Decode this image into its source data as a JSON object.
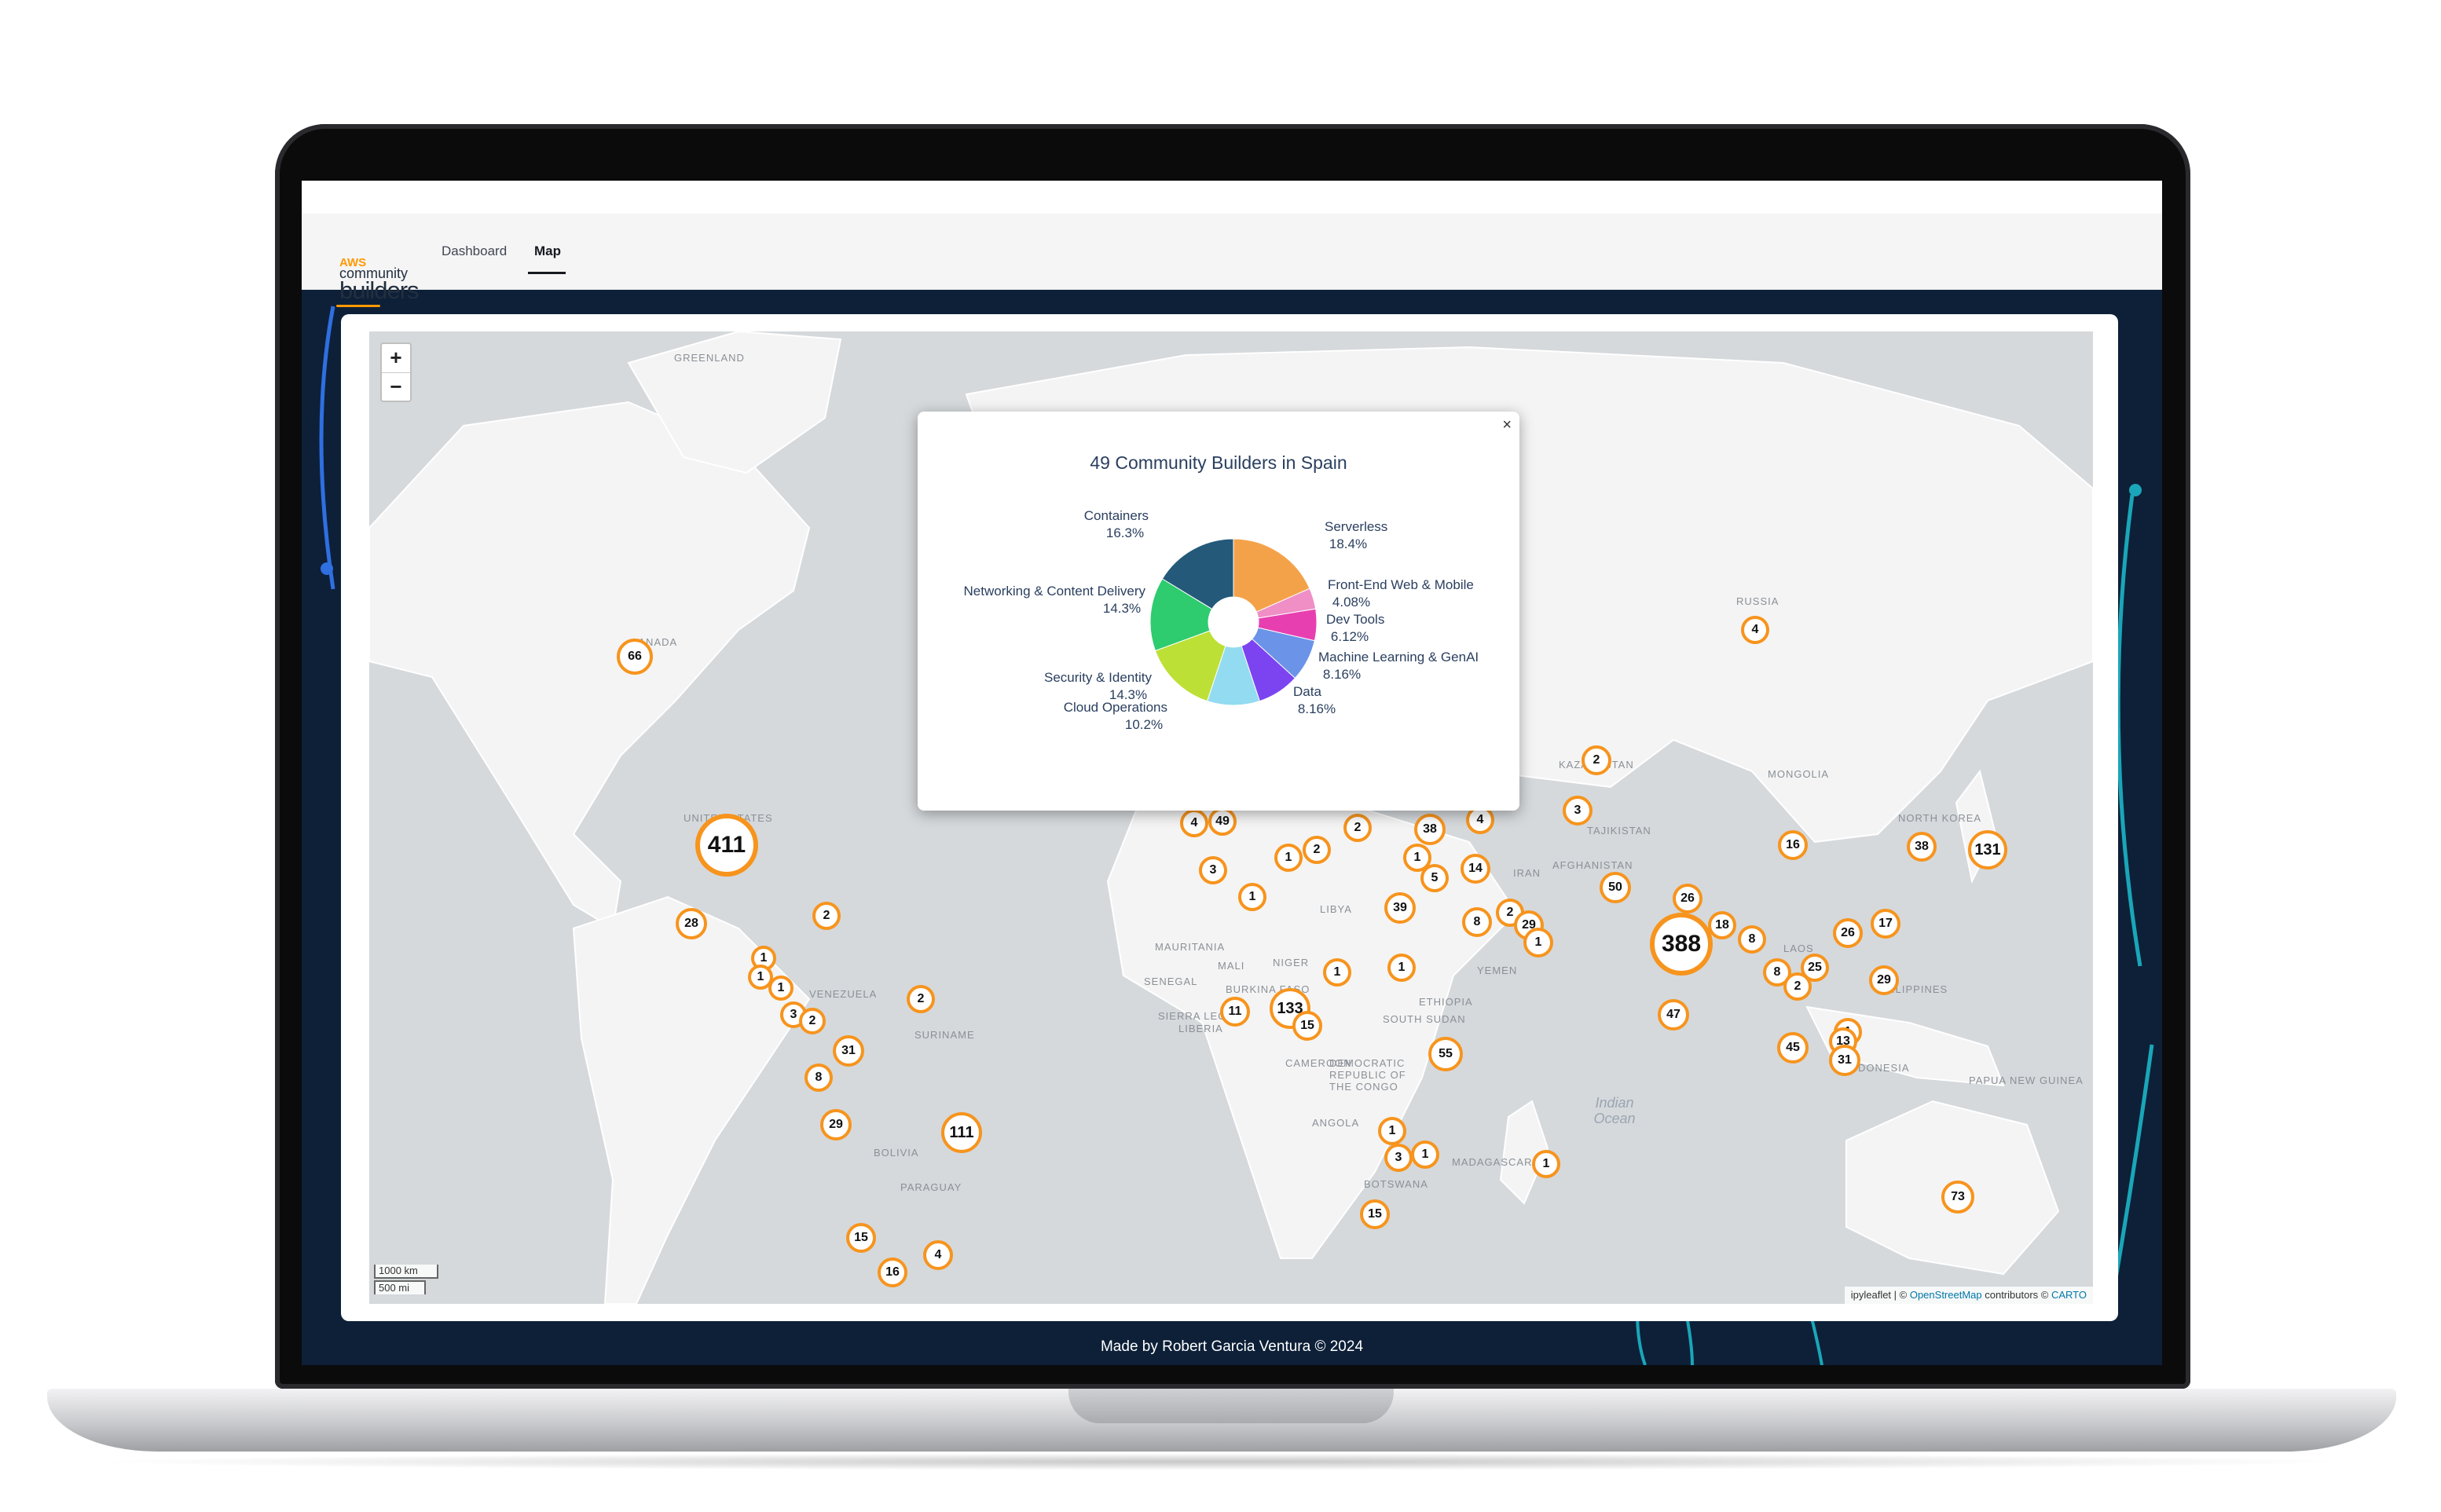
{
  "app": {
    "logo_aws": "AWS",
    "logo_line1": "community",
    "logo_line2": "builders",
    "tabs": [
      {
        "label": "Dashboard",
        "active": false
      },
      {
        "label": "Map",
        "active": true
      }
    ]
  },
  "map": {
    "zoom_in": "+",
    "zoom_out": "−",
    "scale_km": "1000 km",
    "scale_mi": "500 mi",
    "attribution": {
      "prefix": "ipyleaflet | © ",
      "osm": "OpenStreetMap",
      "mid": " contributors © ",
      "carto": "CARTO"
    },
    "place_labels": [
      "GREENLAND",
      "CANADA",
      "UNITED STATES",
      "RUSSIA",
      "KAZAKHSTAN",
      "MONGOLIA",
      "TAJIKISTAN",
      "AFGHANISTAN",
      "IRAN",
      "NORTH KOREA",
      "LAOS",
      "PHILIPPINES",
      "PAPUA NEW GUINEA",
      "INDONESIA",
      "MAURITANIA",
      "MALI",
      "NIGER",
      "LIBYA",
      "SENEGAL",
      "BURKINA FASO",
      "SIERRA LEONE",
      "LIBERIA",
      "CAMEROON",
      "ETHIOPIA",
      "SOUTH SUDAN",
      "DEMOCRATIC REPUBLIC OF THE CONGO",
      "ANGOLA",
      "BOTSWANA",
      "MADAGASCAR",
      "YEMEN",
      "VENEZUELA",
      "SURINAME",
      "BOLIVIA",
      "PARAGUAY",
      "Indian Ocean"
    ],
    "clusters": [
      {
        "count": "66"
      },
      {
        "count": "411"
      },
      {
        "count": "28"
      },
      {
        "count": "2"
      },
      {
        "count": "1"
      },
      {
        "count": "1"
      },
      {
        "count": "1"
      },
      {
        "count": "3"
      },
      {
        "count": "2"
      },
      {
        "count": "2"
      },
      {
        "count": "31"
      },
      {
        "count": "8"
      },
      {
        "count": "29"
      },
      {
        "count": "111"
      },
      {
        "count": "15"
      },
      {
        "count": "16"
      },
      {
        "count": "4"
      },
      {
        "count": "4"
      },
      {
        "count": "49"
      },
      {
        "count": "3"
      },
      {
        "count": "1"
      },
      {
        "count": "2"
      },
      {
        "count": "1"
      },
      {
        "count": "2"
      },
      {
        "count": "38"
      },
      {
        "count": "4"
      },
      {
        "count": "1"
      },
      {
        "count": "5"
      },
      {
        "count": "14"
      },
      {
        "count": "39"
      },
      {
        "count": "8"
      },
      {
        "count": "2"
      },
      {
        "count": "29"
      },
      {
        "count": "1"
      },
      {
        "count": "1"
      },
      {
        "count": "1"
      },
      {
        "count": "11"
      },
      {
        "count": "133"
      },
      {
        "count": "15"
      },
      {
        "count": "55"
      },
      {
        "count": "1"
      },
      {
        "count": "3"
      },
      {
        "count": "1"
      },
      {
        "count": "15"
      },
      {
        "count": "1"
      },
      {
        "count": "4"
      },
      {
        "count": "2"
      },
      {
        "count": "3"
      },
      {
        "count": "50"
      },
      {
        "count": "26"
      },
      {
        "count": "388"
      },
      {
        "count": "18"
      },
      {
        "count": "8"
      },
      {
        "count": "47"
      },
      {
        "count": "16"
      },
      {
        "count": "38"
      },
      {
        "count": "131"
      },
      {
        "count": "26"
      },
      {
        "count": "17"
      },
      {
        "count": "25"
      },
      {
        "count": "8"
      },
      {
        "count": "2"
      },
      {
        "count": "29"
      },
      {
        "count": "1"
      },
      {
        "count": "13"
      },
      {
        "count": "45"
      },
      {
        "count": "31"
      },
      {
        "count": "73"
      }
    ]
  },
  "popup": {
    "close": "×",
    "title": "49 Community Builders in Spain"
  },
  "chart_data": {
    "type": "pie",
    "hole": true,
    "title": "49 Community Builders in Spain",
    "slices": [
      {
        "label": "Serverless",
        "pct": "18.4%",
        "value": 18.4,
        "color": "#f4a24a"
      },
      {
        "label": "Front-End Web & Mobile",
        "pct": "4.08%",
        "value": 4.08,
        "color": "#ef8fc6"
      },
      {
        "label": "Dev Tools",
        "pct": "6.12%",
        "value": 6.12,
        "color": "#e83fb0"
      },
      {
        "label": "Machine Learning & GenAI",
        "pct": "8.16%",
        "value": 8.16,
        "color": "#6b93e8"
      },
      {
        "label": "Data",
        "pct": "8.16%",
        "value": 8.16,
        "color": "#7b44f0"
      },
      {
        "label": "Cloud Operations",
        "pct": "10.2%",
        "value": 10.2,
        "color": "#93dbf0"
      },
      {
        "label": "Security & Identity",
        "pct": "14.3%",
        "value": 14.3,
        "color": "#bde036"
      },
      {
        "label": "Networking & Content Delivery",
        "pct": "14.3%",
        "value": 14.3,
        "color": "#2ecc6e"
      },
      {
        "label": "Containers",
        "pct": "16.3%",
        "value": 16.3,
        "color": "#24597a"
      }
    ]
  },
  "footer": "Made by Robert Garcia Ventura © 2024",
  "colors": {
    "cluster_ring": "#f7941d",
    "accent": "#ff9900",
    "background": "#0d2038"
  }
}
